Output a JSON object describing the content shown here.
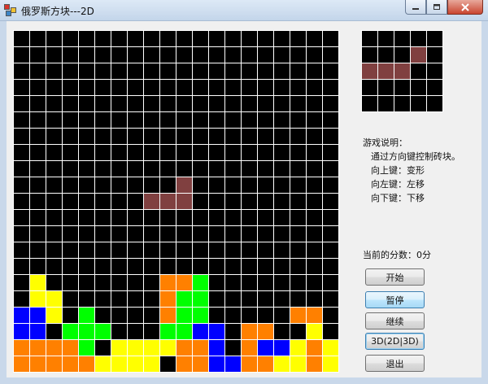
{
  "window": {
    "title": "俄罗斯方块---2D"
  },
  "palette": {
    "0": "#000000",
    "y": "#ffff00",
    "o": "#ff8000",
    "g": "#00ff00",
    "b": "#0000ff",
    "p": "#804040"
  },
  "board": {
    "cols": 20,
    "rows": 21,
    "cells": [
      "00000000000000000000",
      "00000000000000000000",
      "00000000000000000000",
      "00000000000000000000",
      "00000000000000000000",
      "00000000000000000000",
      "00000000000000000000",
      "00000000000000000000",
      "00000000000000000000",
      "0000000000p000000000",
      "00000000ppp000000000",
      "00000000000000000000",
      "00000000000000000000",
      "00000000000000000000",
      "00000000000000000000",
      "0y0000000oog00000000",
      "0yy000000ogg00000000",
      "bby0g0000ogg00000oo0",
      "bb0ggg000ggbb0oo00y0",
      "oooog0yyyyoob0obbyoy",
      "oooooyyyy0oobbooyyoy"
    ]
  },
  "preview": {
    "cols": 5,
    "rows": 5,
    "cells": [
      "00000",
      "000p0",
      "ppp00",
      "00000",
      "00000"
    ]
  },
  "instructions": {
    "title": "游戏说明：",
    "lines": [
      "通过方向键控制砖块。",
      "向上键：变形",
      "向左键：左移",
      "向下键：下移"
    ]
  },
  "score": {
    "label": "当前的分数：",
    "value": "0",
    "unit": "分"
  },
  "buttons": {
    "start": "开始",
    "pause": "暂停",
    "resume": "继续",
    "mode": "3D(2D|3D)",
    "exit": "退出"
  }
}
